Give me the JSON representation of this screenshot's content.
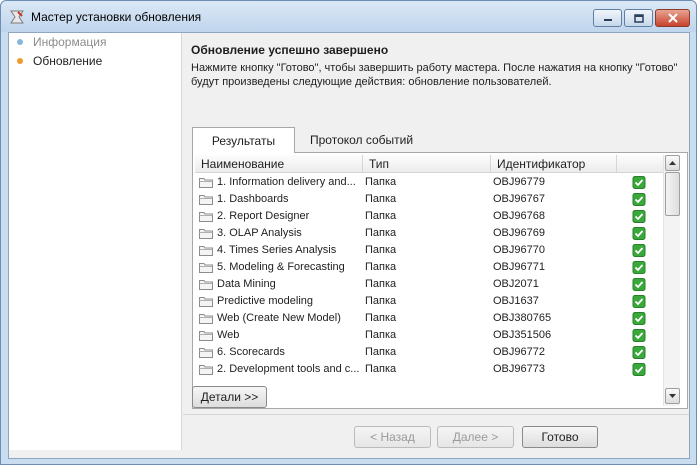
{
  "window": {
    "title": "Мастер установки обновления"
  },
  "sidebar": {
    "steps": [
      {
        "label": "Информация",
        "state": "done"
      },
      {
        "label": "Обновление",
        "state": "current"
      }
    ]
  },
  "header": {
    "title": "Обновление успешно завершено",
    "description": "Нажмите кнопку \"Готово\", чтобы завершить работу мастера. После нажатия на кнопку \"Готово\" будут произведены следующие действия: обновление пользователей."
  },
  "tabs": [
    {
      "label": "Результаты",
      "active": true
    },
    {
      "label": "Протокол событий",
      "active": false
    }
  ],
  "grid": {
    "columns": [
      "Наименование",
      "Тип",
      "Идентификатор",
      ""
    ],
    "rows": [
      {
        "name": "1. Information delivery and...",
        "type": "Папка",
        "id": "OBJ96779",
        "ok": true
      },
      {
        "name": "1. Dashboards",
        "type": "Папка",
        "id": "OBJ96767",
        "ok": true
      },
      {
        "name": "2. Report Designer",
        "type": "Папка",
        "id": "OBJ96768",
        "ok": true
      },
      {
        "name": "3. OLAP Analysis",
        "type": "Папка",
        "id": "OBJ96769",
        "ok": true
      },
      {
        "name": "4. Times Series Analysis",
        "type": "Папка",
        "id": "OBJ96770",
        "ok": true
      },
      {
        "name": "5. Modeling & Forecasting",
        "type": "Папка",
        "id": "OBJ96771",
        "ok": true
      },
      {
        "name": "Data Mining",
        "type": "Папка",
        "id": "OBJ2071",
        "ok": true
      },
      {
        "name": "Predictive modeling",
        "type": "Папка",
        "id": "OBJ1637",
        "ok": true
      },
      {
        "name": "Web (Create New Model)",
        "type": "Папка",
        "id": "OBJ380765",
        "ok": true
      },
      {
        "name": "Web",
        "type": "Папка",
        "id": "OBJ351506",
        "ok": true
      },
      {
        "name": "6. Scorecards",
        "type": "Папка",
        "id": "OBJ96772",
        "ok": true
      },
      {
        "name": "2. Development tools and c...",
        "type": "Папка",
        "id": "OBJ96773",
        "ok": true
      }
    ]
  },
  "buttons": {
    "details": "Детали >>",
    "back": "< Назад",
    "next": "Далее >",
    "finish": "Готово"
  },
  "colors": {
    "step_done": "#86b6dd",
    "step_current": "#f29b2a",
    "check_ok": "#3aa83a"
  },
  "icons": {
    "title": "wizard-icon",
    "folder": "folder-icon",
    "check": "check-icon"
  }
}
